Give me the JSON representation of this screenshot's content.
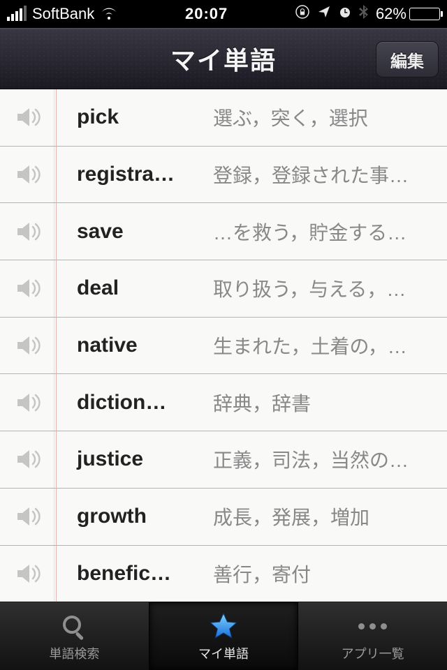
{
  "status": {
    "carrier": "SoftBank",
    "time": "20:07",
    "battery_pct": "62%"
  },
  "nav": {
    "title": "マイ単語",
    "edit_label": "編集"
  },
  "words": [
    {
      "term": "pick",
      "definition": "選ぶ，突く，選択"
    },
    {
      "term": "registra…",
      "definition": "登録，登録された事…"
    },
    {
      "term": "save",
      "definition": "…を救う，貯金する…"
    },
    {
      "term": "deal",
      "definition": "取り扱う，与える，…"
    },
    {
      "term": "native",
      "definition": "生まれた，土着の，…"
    },
    {
      "term": "diction…",
      "definition": "辞典，辞書"
    },
    {
      "term": "justice",
      "definition": "正義，司法，当然の…"
    },
    {
      "term": "growth",
      "definition": "成長，発展，増加"
    },
    {
      "term": "benefic…",
      "definition": "善行，寄付"
    }
  ],
  "tabs": {
    "search": "単語検索",
    "my_words": "マイ単語",
    "apps": "アプリ一覧"
  }
}
